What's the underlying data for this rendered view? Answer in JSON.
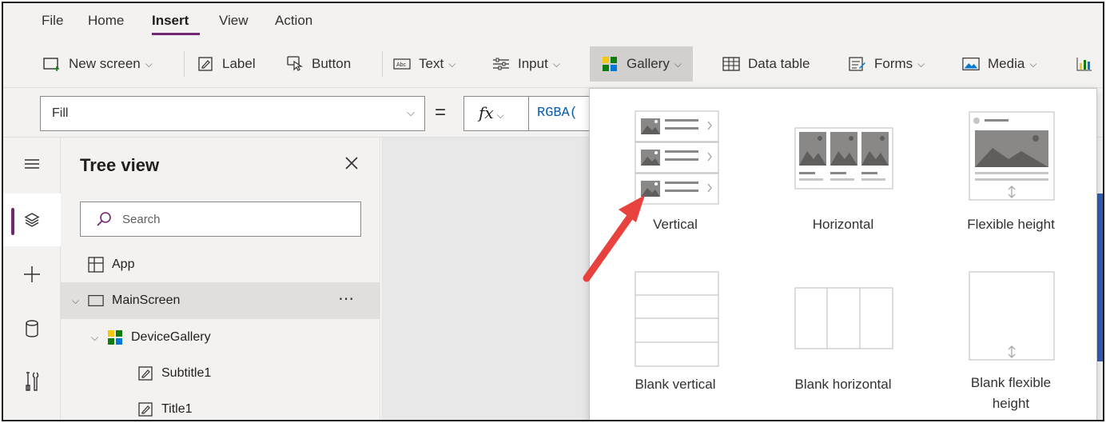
{
  "menubar": {
    "items": [
      {
        "label": "File",
        "active": false
      },
      {
        "label": "Home",
        "active": false
      },
      {
        "label": "Insert",
        "active": true
      },
      {
        "label": "View",
        "active": false
      },
      {
        "label": "Action",
        "active": false
      }
    ],
    "accent": "#742774"
  },
  "ribbon": {
    "new_screen": "New screen",
    "label": "Label",
    "button": "Button",
    "text": "Text",
    "input": "Input",
    "gallery": "Gallery",
    "data_table": "Data table",
    "forms": "Forms",
    "media": "Media"
  },
  "formula_bar": {
    "property": "Fill",
    "equals": "=",
    "fx": "fx",
    "formula": "RGBA("
  },
  "rail": {
    "icons": [
      "hamburger-icon",
      "layers-icon",
      "plus-icon",
      "database-icon",
      "tools-icon"
    ]
  },
  "tree": {
    "title": "Tree view",
    "search_placeholder": "Search",
    "nodes": [
      {
        "label": "App"
      },
      {
        "label": "MainScreen",
        "more": "⋯"
      },
      {
        "label": "DeviceGallery"
      },
      {
        "label": "Subtitle1"
      },
      {
        "label": "Title1"
      }
    ]
  },
  "gallery_menu": {
    "options": [
      {
        "label": "Vertical"
      },
      {
        "label": "Horizontal"
      },
      {
        "label": "Flexible height"
      },
      {
        "label": "Blank vertical"
      },
      {
        "label": "Blank horizontal"
      },
      {
        "label": "Blank flexible height"
      }
    ]
  },
  "colors": {
    "accent": "#742774",
    "arrow": "#e8423f",
    "formula_text": "#0b5cad",
    "selection": "#d2d0ce"
  }
}
